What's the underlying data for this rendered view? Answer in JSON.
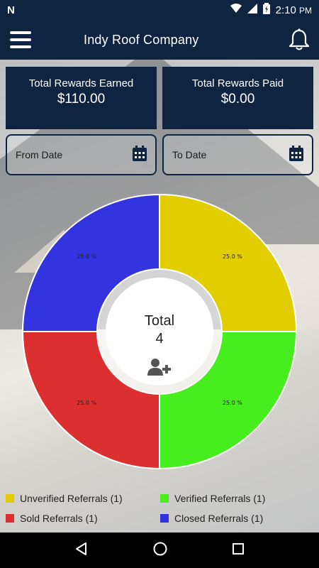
{
  "status_bar": {
    "time": "2:10",
    "ampm": "PM"
  },
  "app_bar": {
    "title": "Indy Roof Company"
  },
  "cards": [
    {
      "label": "Total Rewards Earned",
      "value": "$110.00"
    },
    {
      "label": "Total Rewards Paid",
      "value": "$0.00"
    }
  ],
  "filters": {
    "from_label": "From Date",
    "to_label": "To Date"
  },
  "chart_data": {
    "type": "pie",
    "categories": [
      "Unverified Referrals",
      "Verified Referrals",
      "Sold Referrals",
      "Closed Referrals"
    ],
    "values": [
      25.0,
      25.0,
      25.0,
      25.0
    ],
    "slice_labels": [
      "25.0 %",
      "25.0 %",
      "25.0 %",
      "25.0 %"
    ],
    "colors": [
      "#e2cd00",
      "#46ee1e",
      "#dc2f2f",
      "#3433e0"
    ],
    "center_title": "Total",
    "center_value": "4"
  },
  "legend": [
    {
      "label": "Unverified Referrals (1)",
      "color": "#e2cd00"
    },
    {
      "label": "Verified Referrals (1)",
      "color": "#46ee1e"
    },
    {
      "label": "Sold Referrals (1)",
      "color": "#dc2f2f"
    },
    {
      "label": "Closed Referrals (1)",
      "color": "#3433e0"
    }
  ]
}
